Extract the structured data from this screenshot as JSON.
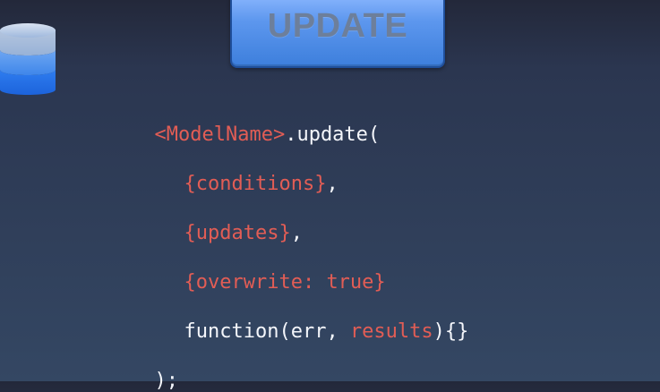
{
  "slide": {
    "title": "UPDATE",
    "code": {
      "line1": {
        "model": "<ModelName>",
        "rest": ".update("
      },
      "line2": {
        "text": "{conditions}",
        "tail": ","
      },
      "line3": {
        "text": "{updates}",
        "tail": ","
      },
      "line4": {
        "text": "{overwrite: true}"
      },
      "line5": {
        "prefix": "function(err, ",
        "param": "results",
        "suffix": "){}"
      },
      "line6": {
        "text": ");"
      }
    },
    "icons": {
      "database": "database-icon"
    },
    "colors": {
      "code_white": "#f4f6fb",
      "code_red": "#e25d55",
      "button_blue": "#3d7fdc",
      "title_gray": "#6d7f9b"
    }
  }
}
